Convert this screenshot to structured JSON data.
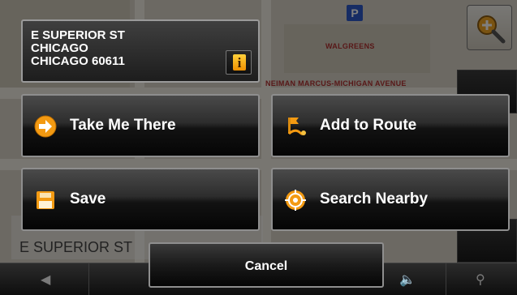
{
  "address": {
    "street": "E SUPERIOR ST",
    "city": "CHICAGO",
    "city_zip": "CHICAGO 60611",
    "info_label": "i"
  },
  "map": {
    "poi_walgreens": "WALGREENS",
    "poi_neiman": "NEIMAN MARCUS-MICHIGAN AVENUE",
    "parking_label": "P",
    "current_street": "E SUPERIOR ST"
  },
  "actions": {
    "take_me_there": "Take Me There",
    "add_to_route": "Add to Route",
    "save": "Save",
    "search_nearby": "Search Nearby"
  },
  "cancel_label": "Cancel",
  "icons": {
    "take_me_there": "arrow-right-circle-icon",
    "add_to_route": "route-flag-icon",
    "save": "save-disk-icon",
    "search_nearby": "target-crosshair-icon",
    "info": "info-icon",
    "zoom": "zoom-in-icon"
  },
  "colors": {
    "accent_orange": "#f39a12",
    "button_border": "#8e8e8e",
    "text": "#ffffff"
  }
}
